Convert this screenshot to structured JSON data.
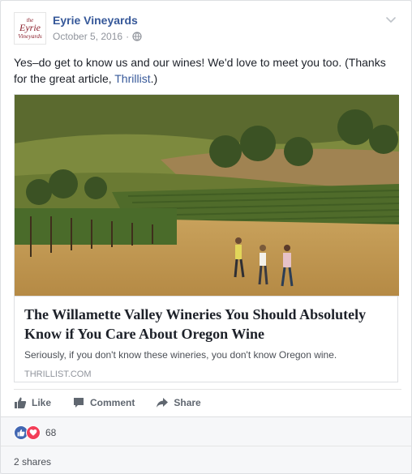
{
  "post": {
    "page_name": "Eyrie Vineyards",
    "avatar_text": [
      "the",
      "Eyrie",
      "Vineyards"
    ],
    "date": "October 5, 2016",
    "privacy_separator": "·",
    "privacy_icon": "globe-icon",
    "text_main": "Yes–do get to know us and our wines! We'd love to meet you too. (Thanks for the great article, ",
    "text_link": "Thrillist",
    "text_end": ".)"
  },
  "shared_link": {
    "image_description_icon": "vineyard-photo",
    "title": "The Willamette Valley Wineries You Should Absolutely Know if You Care About Oregon Wine",
    "description": "Seriously, if you don't know these wineries, you don't know Oregon wine.",
    "domain": "THRILLIST.COM"
  },
  "actions": {
    "like_label": "Like",
    "comment_label": "Comment",
    "share_label": "Share"
  },
  "stats": {
    "reaction_count": "68",
    "shares_text": "2 shares"
  },
  "colors": {
    "link_blue": "#365899",
    "like_blue": "#4267b2",
    "love_red": "#f33e58"
  }
}
